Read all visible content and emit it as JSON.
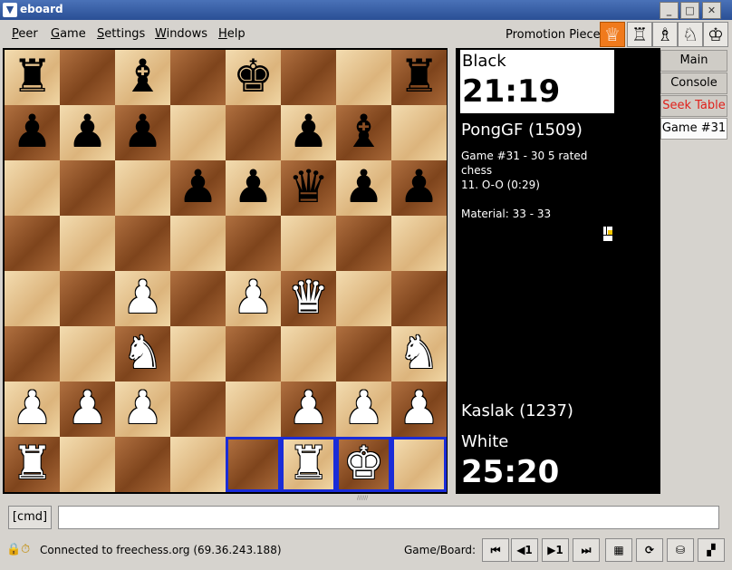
{
  "window": {
    "title": "eboard",
    "icon": "chevron-down-icon"
  },
  "menubar": {
    "items": [
      {
        "mnemonic": "P",
        "rest": "eer"
      },
      {
        "mnemonic": "G",
        "rest": "ame"
      },
      {
        "mnemonic": "S",
        "rest": "ettings"
      },
      {
        "mnemonic": "W",
        "rest": "indows"
      },
      {
        "mnemonic": "H",
        "rest": "elp"
      }
    ]
  },
  "promotion": {
    "label": "Promotion Piece",
    "pieces": [
      {
        "name": "queen",
        "glyph": "♕",
        "selected": true
      },
      {
        "name": "rook",
        "glyph": "♖",
        "selected": false
      },
      {
        "name": "bishop",
        "glyph": "♗",
        "selected": false
      },
      {
        "name": "knight",
        "glyph": "♘",
        "selected": false
      },
      {
        "name": "king",
        "glyph": "♔",
        "selected": false
      }
    ]
  },
  "board": {
    "rows": [
      [
        "r",
        "",
        "b",
        "",
        "k",
        "",
        "",
        "r"
      ],
      [
        "p",
        "p",
        "p",
        "",
        "",
        "p",
        "b",
        ""
      ],
      [
        "",
        "",
        "",
        "p",
        "p",
        "q",
        "p",
        "p"
      ],
      [
        "",
        "",
        "",
        "",
        "",
        "",
        "",
        ""
      ],
      [
        "",
        "",
        "P",
        "",
        "P",
        "Q",
        "",
        ""
      ],
      [
        "",
        "",
        "N",
        "",
        "",
        "",
        "",
        "N"
      ],
      [
        "P",
        "P",
        "P",
        "",
        "",
        "P",
        "P",
        "P"
      ],
      [
        "R",
        "",
        "",
        "",
        "",
        "R",
        "K",
        ""
      ]
    ],
    "highlight_color": "#1a2cd8",
    "highlighted": [
      "7-4",
      "7-5",
      "7-6",
      "7-7"
    ]
  },
  "black": {
    "label": "Black",
    "time": "21:19",
    "name": "PongGF (1509)"
  },
  "game_info": {
    "line1": "Game #31 - 30 5 rated",
    "line2": "chess",
    "line3": "11. O-O (0:29)",
    "material": "Material: 33 - 33"
  },
  "white": {
    "label": "White",
    "time": "25:20",
    "name": "Kaslak (1237)"
  },
  "tabs": [
    {
      "label": "Main Board",
      "active": false,
      "red": false
    },
    {
      "label": "Console",
      "active": false,
      "red": false
    },
    {
      "label": "Seek Table",
      "active": false,
      "red": true
    },
    {
      "label": "Game #31",
      "active": true,
      "red": false
    }
  ],
  "command": {
    "button": "[cmd]",
    "value": ""
  },
  "status": {
    "text": "Connected to freechess.org (69.36.243.188)",
    "game_board_label": "Game/Board:",
    "nav": [
      "⏮",
      "◀1",
      "▶1",
      "⏭",
      "▦",
      "⟳",
      "⛁",
      "▞"
    ]
  },
  "colors": {
    "promo_selected": "#f07a1c",
    "seek_table_text": "#e0201a"
  }
}
